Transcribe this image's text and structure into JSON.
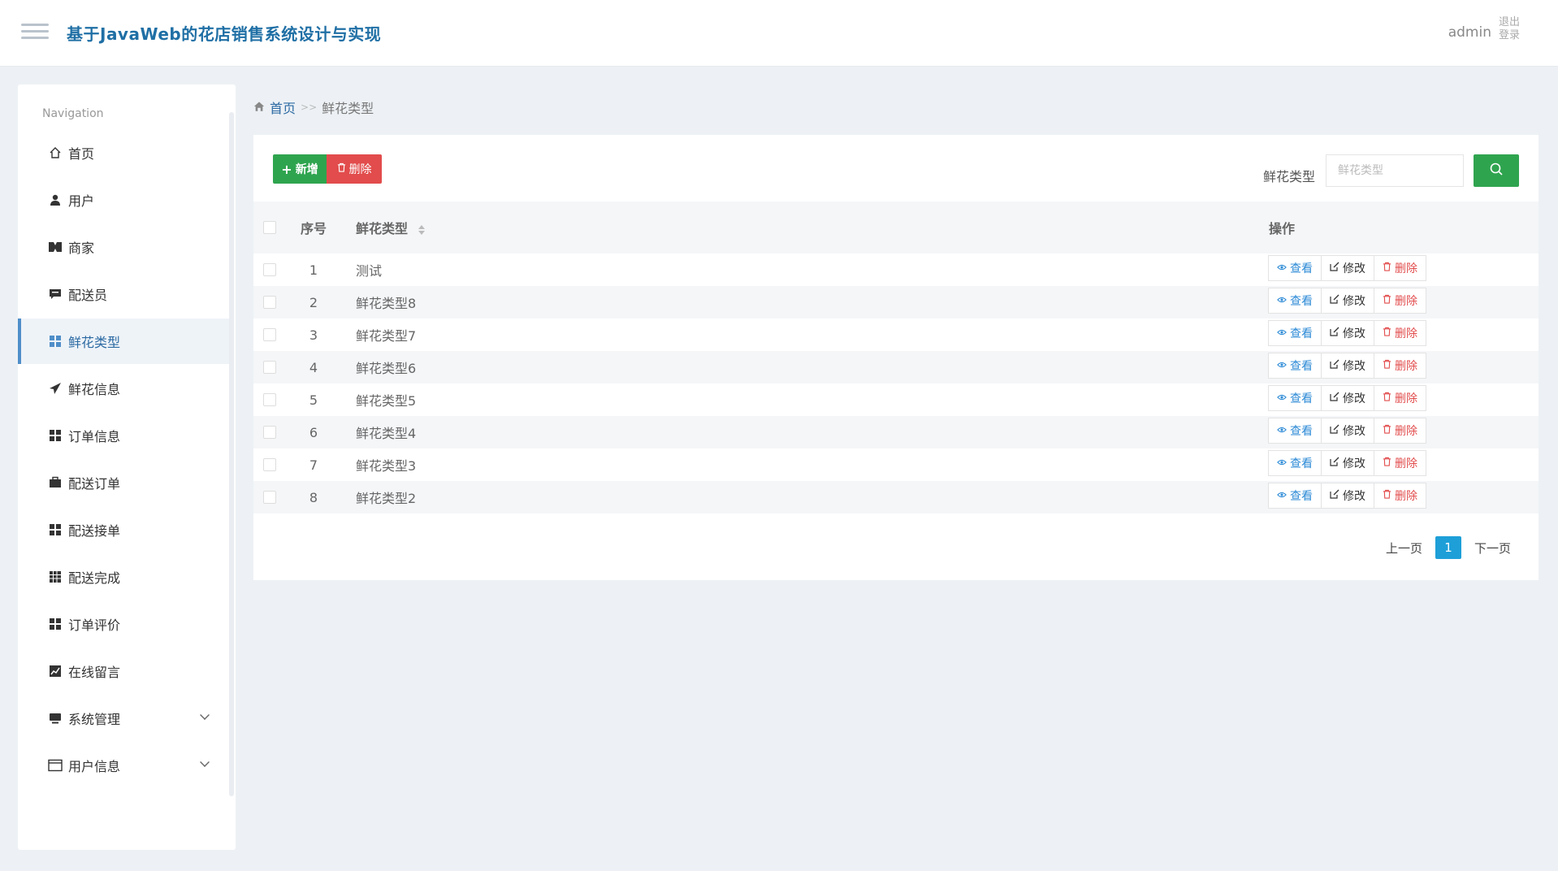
{
  "header": {
    "title": "基于JavaWeb的花店销售系统设计与实现",
    "user": "admin",
    "logout": "退出登录"
  },
  "sidebar": {
    "heading": "Navigation",
    "items": [
      {
        "label": "首页",
        "icon": "home-icon"
      },
      {
        "label": "用户",
        "icon": "user-icon"
      },
      {
        "label": "商家",
        "icon": "store-icon"
      },
      {
        "label": "配送员",
        "icon": "chat-icon"
      },
      {
        "label": "鲜花类型",
        "icon": "grid-icon",
        "active": true
      },
      {
        "label": "鲜花信息",
        "icon": "send-icon"
      },
      {
        "label": "订单信息",
        "icon": "grid-icon"
      },
      {
        "label": "配送订单",
        "icon": "briefcase-icon"
      },
      {
        "label": "配送接单",
        "icon": "grid-icon"
      },
      {
        "label": "配送完成",
        "icon": "table-icon"
      },
      {
        "label": "订单评价",
        "icon": "grid-icon"
      },
      {
        "label": "在线留言",
        "icon": "chart-icon"
      },
      {
        "label": "系统管理",
        "icon": "monitor-icon",
        "expandable": true
      },
      {
        "label": "用户信息",
        "icon": "window-icon",
        "expandable": true
      }
    ]
  },
  "breadcrumb": {
    "home": "首页",
    "separator": ">>",
    "current": "鲜花类型"
  },
  "toolbar": {
    "add_label": "新增",
    "delete_label": "删除"
  },
  "search": {
    "label": "鲜花类型",
    "placeholder": "鲜花类型"
  },
  "table": {
    "headers": {
      "index": "序号",
      "name": "鲜花类型",
      "actions": "操作"
    },
    "actions": {
      "view": "查看",
      "edit": "修改",
      "delete": "删除"
    },
    "rows": [
      {
        "index": "1",
        "name": "测试"
      },
      {
        "index": "2",
        "name": "鲜花类型8"
      },
      {
        "index": "3",
        "name": "鲜花类型7"
      },
      {
        "index": "4",
        "name": "鲜花类型6"
      },
      {
        "index": "5",
        "name": "鲜花类型5"
      },
      {
        "index": "6",
        "name": "鲜花类型4"
      },
      {
        "index": "7",
        "name": "鲜花类型3"
      },
      {
        "index": "8",
        "name": "鲜花类型2"
      }
    ]
  },
  "pagination": {
    "prev": "上一页",
    "current": "1",
    "next": "下一页"
  },
  "colors": {
    "primary": "#2fa44f",
    "danger": "#e24c4c",
    "link": "#2c8ad6",
    "title": "#1f6fa5",
    "page_active": "#1e9fd8"
  }
}
